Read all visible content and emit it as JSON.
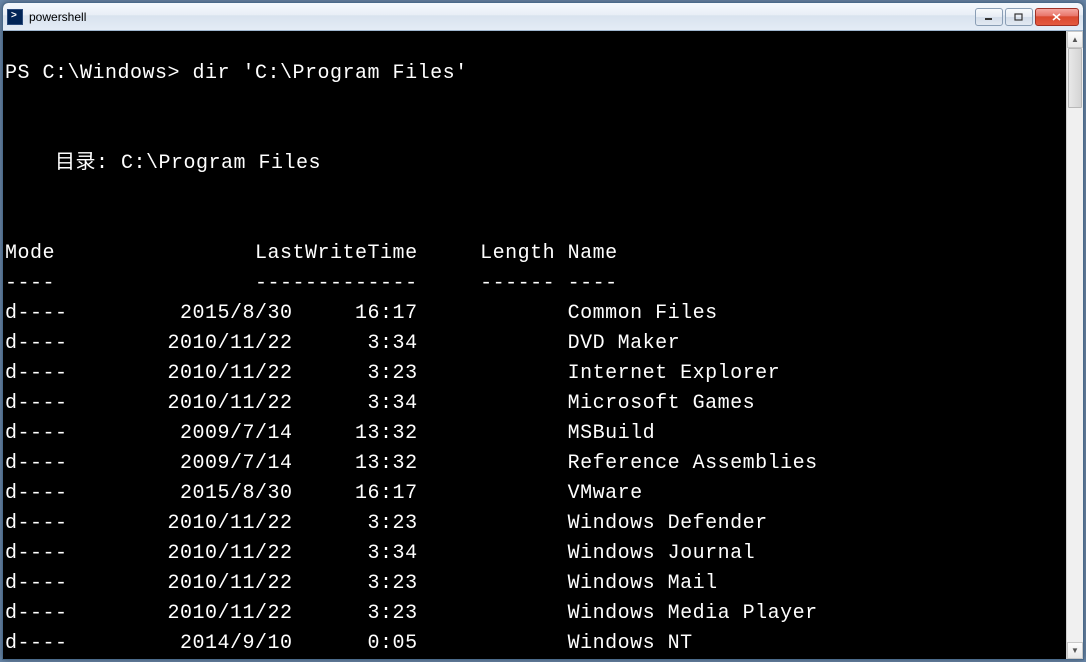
{
  "window": {
    "title": "powershell"
  },
  "console": {
    "prompt": "PS C:\\Windows> dir 'C:\\Program Files'",
    "dir_label": "    目录: C:\\Program Files",
    "header": "Mode                LastWriteTime     Length Name",
    "separator": "----                -------------     ------ ----",
    "rows": [
      {
        "mode": "d----",
        "date": "2015/8/30",
        "time": "16:17",
        "length": "",
        "name": "Common Files"
      },
      {
        "mode": "d----",
        "date": "2010/11/22",
        "time": "3:34",
        "length": "",
        "name": "DVD Maker"
      },
      {
        "mode": "d----",
        "date": "2010/11/22",
        "time": "3:23",
        "length": "",
        "name": "Internet Explorer"
      },
      {
        "mode": "d----",
        "date": "2010/11/22",
        "time": "3:34",
        "length": "",
        "name": "Microsoft Games"
      },
      {
        "mode": "d----",
        "date": "2009/7/14",
        "time": "13:32",
        "length": "",
        "name": "MSBuild"
      },
      {
        "mode": "d----",
        "date": "2009/7/14",
        "time": "13:32",
        "length": "",
        "name": "Reference Assemblies"
      },
      {
        "mode": "d----",
        "date": "2015/8/30",
        "time": "16:17",
        "length": "",
        "name": "VMware"
      },
      {
        "mode": "d----",
        "date": "2010/11/22",
        "time": "3:23",
        "length": "",
        "name": "Windows Defender"
      },
      {
        "mode": "d----",
        "date": "2010/11/22",
        "time": "3:34",
        "length": "",
        "name": "Windows Journal"
      },
      {
        "mode": "d----",
        "date": "2010/11/22",
        "time": "3:23",
        "length": "",
        "name": "Windows Mail"
      },
      {
        "mode": "d----",
        "date": "2010/11/22",
        "time": "3:23",
        "length": "",
        "name": "Windows Media Player"
      },
      {
        "mode": "d----",
        "date": "2014/9/10",
        "time": "0:05",
        "length": "",
        "name": "Windows NT"
      }
    ]
  }
}
